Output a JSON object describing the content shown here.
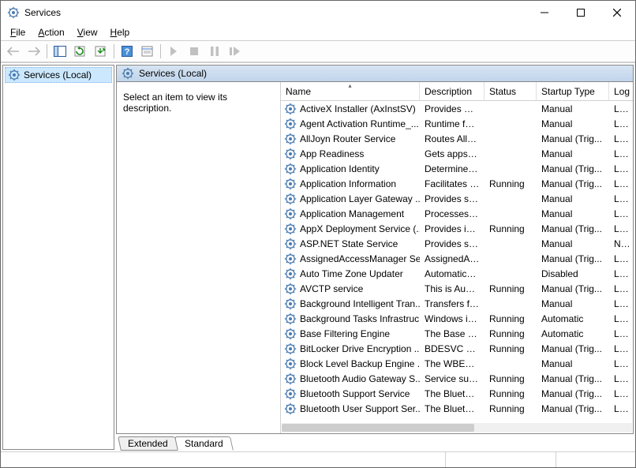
{
  "window": {
    "title": "Services"
  },
  "menus": {
    "file": "File",
    "action": "Action",
    "view": "View",
    "help": "Help"
  },
  "toolbar_icons": {
    "back": "back-arrow",
    "forward": "forward-arrow",
    "show_hide": "show-hide-tree",
    "export": "export-list",
    "help2": "help",
    "refresh": "refresh",
    "start": "start",
    "stop": "stop",
    "pause": "pause",
    "restart": "restart",
    "props": "properties"
  },
  "tree": {
    "root": "Services (Local)"
  },
  "detail": {
    "header": "Services (Local)",
    "prompt": "Select an item to view its description."
  },
  "columns": {
    "name": "Name",
    "desc": "Description",
    "status": "Status",
    "startup": "Startup Type",
    "logon": "Log On As"
  },
  "tabs": {
    "extended": "Extended",
    "standard": "Standard"
  },
  "services": [
    {
      "name": "ActiveX Installer (AxInstSV)",
      "desc": "Provides Us...",
      "status": "",
      "startup": "Manual",
      "logon": "Local"
    },
    {
      "name": "Agent Activation Runtime_...",
      "desc": "Runtime for...",
      "status": "",
      "startup": "Manual",
      "logon": "Local"
    },
    {
      "name": "AllJoyn Router Service",
      "desc": "Routes AllJo...",
      "status": "",
      "startup": "Manual (Trig...",
      "logon": "Local"
    },
    {
      "name": "App Readiness",
      "desc": "Gets apps re...",
      "status": "",
      "startup": "Manual",
      "logon": "Local"
    },
    {
      "name": "Application Identity",
      "desc": "Determines ...",
      "status": "",
      "startup": "Manual (Trig...",
      "logon": "Local"
    },
    {
      "name": "Application Information",
      "desc": "Facilitates t...",
      "status": "Running",
      "startup": "Manual (Trig...",
      "logon": "Local"
    },
    {
      "name": "Application Layer Gateway ...",
      "desc": "Provides su...",
      "status": "",
      "startup": "Manual",
      "logon": "Local"
    },
    {
      "name": "Application Management",
      "desc": "Processes in...",
      "status": "",
      "startup": "Manual",
      "logon": "Local"
    },
    {
      "name": "AppX Deployment Service (...",
      "desc": "Provides inf...",
      "status": "Running",
      "startup": "Manual (Trig...",
      "logon": "Local"
    },
    {
      "name": "ASP.NET State Service",
      "desc": "Provides su...",
      "status": "",
      "startup": "Manual",
      "logon": "Netw"
    },
    {
      "name": "AssignedAccessManager Se...",
      "desc": "AssignedAc...",
      "status": "",
      "startup": "Manual (Trig...",
      "logon": "Local"
    },
    {
      "name": "Auto Time Zone Updater",
      "desc": "Automatica...",
      "status": "",
      "startup": "Disabled",
      "logon": "Local"
    },
    {
      "name": "AVCTP service",
      "desc": "This is Audi...",
      "status": "Running",
      "startup": "Manual (Trig...",
      "logon": "Local"
    },
    {
      "name": "Background Intelligent Tran...",
      "desc": "Transfers fil...",
      "status": "",
      "startup": "Manual",
      "logon": "Local"
    },
    {
      "name": "Background Tasks Infrastruc...",
      "desc": "Windows in...",
      "status": "Running",
      "startup": "Automatic",
      "logon": "Local"
    },
    {
      "name": "Base Filtering Engine",
      "desc": "The Base Fil...",
      "status": "Running",
      "startup": "Automatic",
      "logon": "Local"
    },
    {
      "name": "BitLocker Drive Encryption ...",
      "desc": "BDESVC hos...",
      "status": "Running",
      "startup": "Manual (Trig...",
      "logon": "Local"
    },
    {
      "name": "Block Level Backup Engine ...",
      "desc": "The WBENG...",
      "status": "",
      "startup": "Manual",
      "logon": "Local"
    },
    {
      "name": "Bluetooth Audio Gateway S...",
      "desc": "Service sup...",
      "status": "Running",
      "startup": "Manual (Trig...",
      "logon": "Local"
    },
    {
      "name": "Bluetooth Support Service",
      "desc": "The Bluetoo...",
      "status": "Running",
      "startup": "Manual (Trig...",
      "logon": "Local"
    },
    {
      "name": "Bluetooth User Support Ser...",
      "desc": "The Bluetoo...",
      "status": "Running",
      "startup": "Manual (Trig...",
      "logon": "Local"
    }
  ]
}
